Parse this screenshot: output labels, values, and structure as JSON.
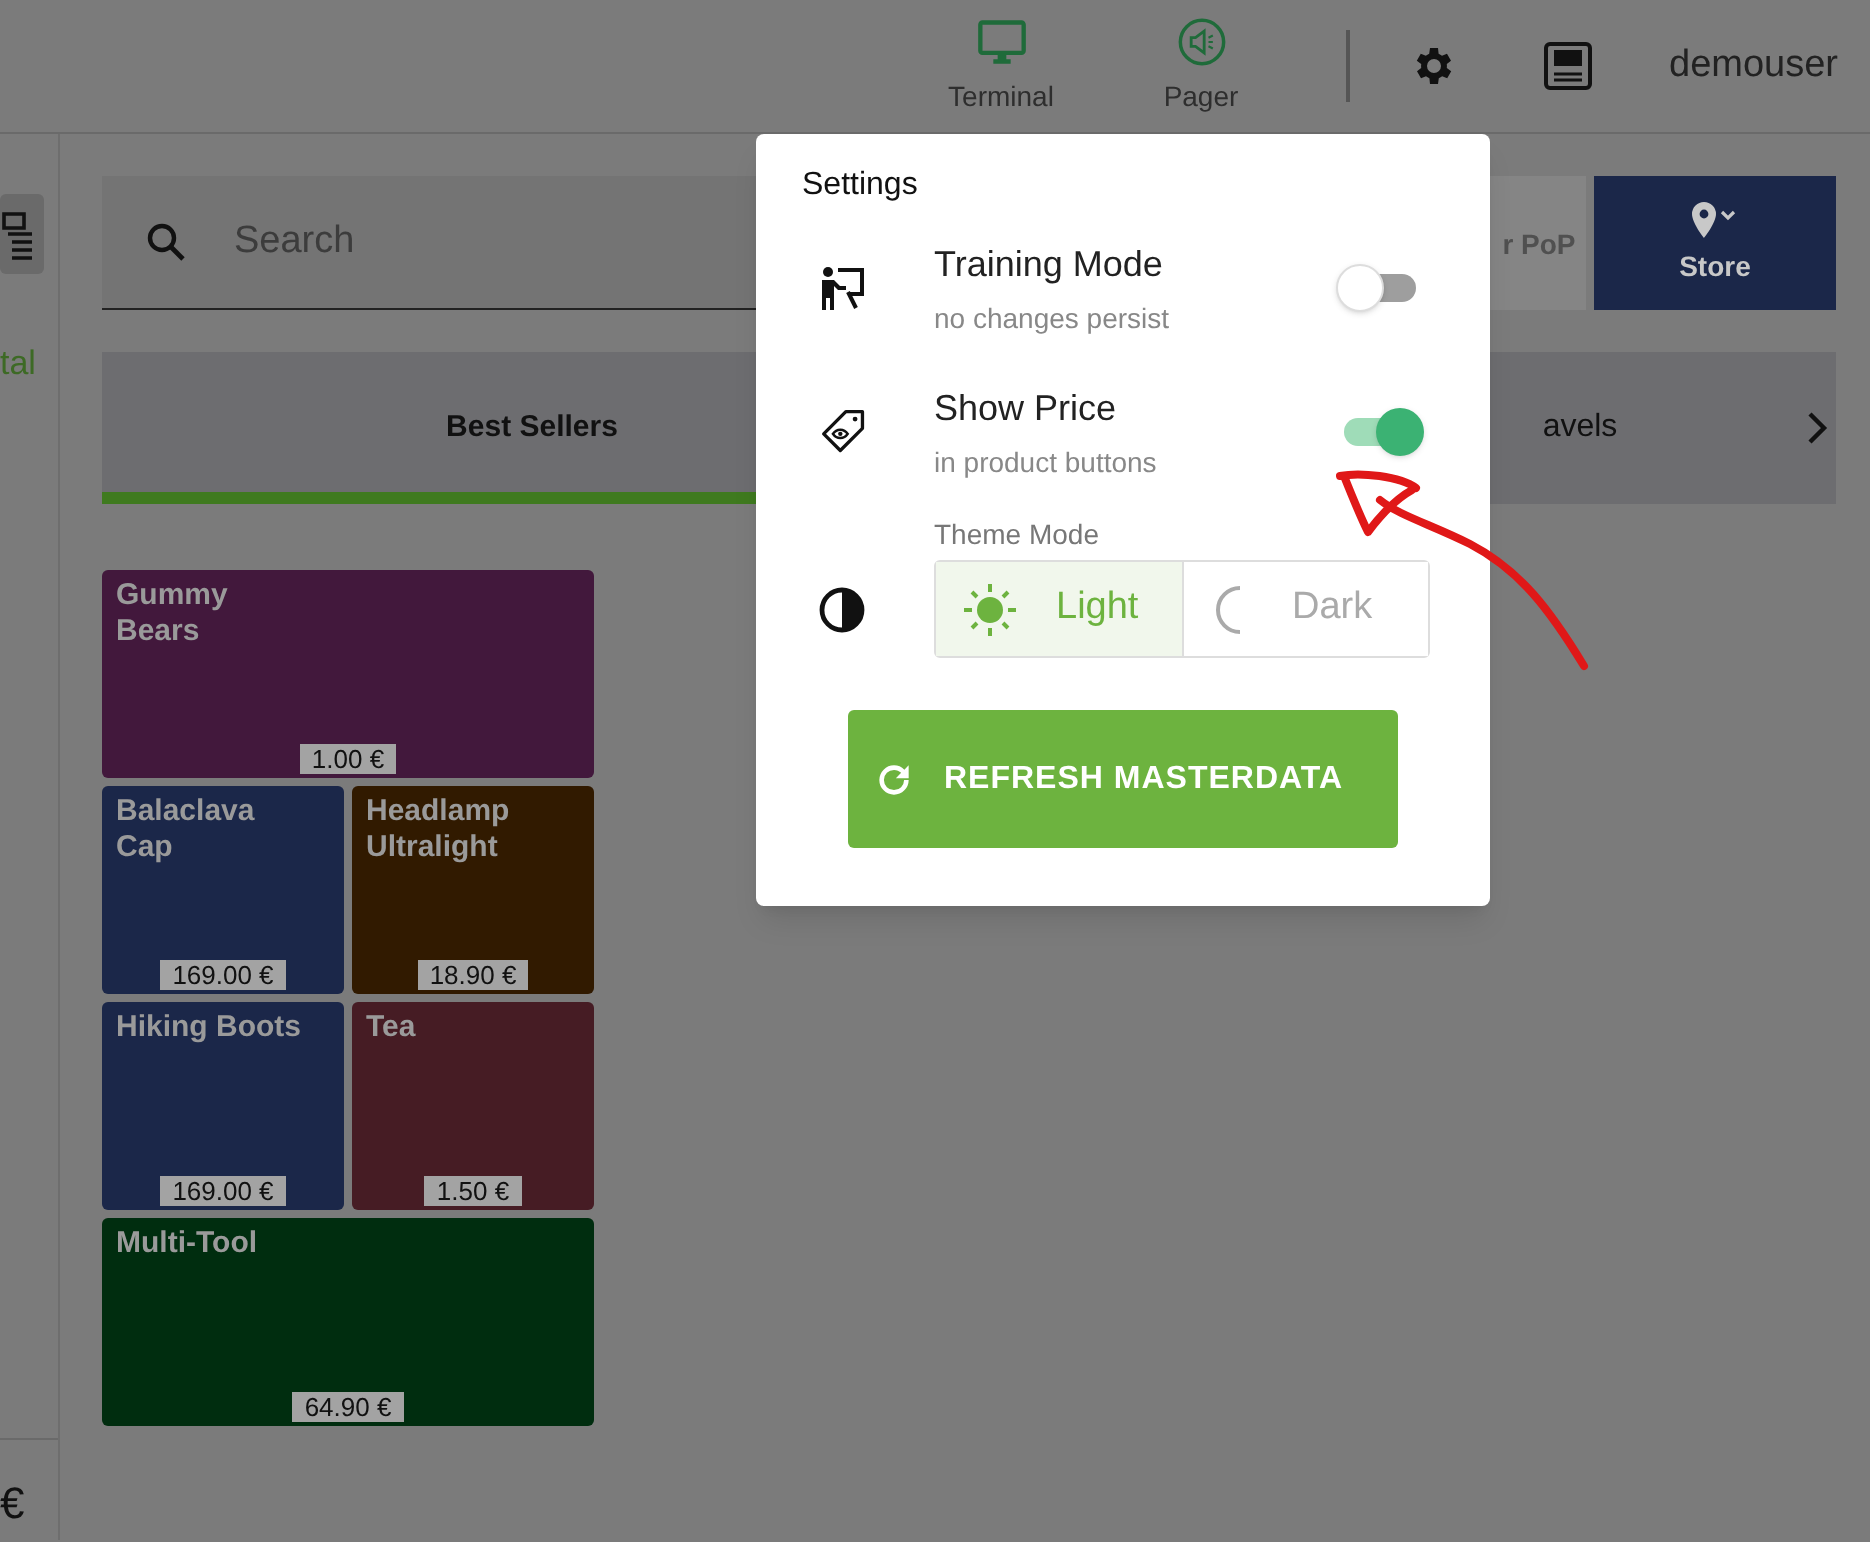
{
  "header": {
    "nav": [
      {
        "label": "Terminal",
        "kind": "terminal"
      },
      {
        "label": "Pager",
        "kind": "pager"
      }
    ],
    "user": "demouser"
  },
  "sidebar": {
    "label": "tal",
    "amount": "€"
  },
  "search": {
    "placeholder": "Search"
  },
  "actions": [
    {
      "label": "r PoP",
      "disabled": true
    },
    {
      "label": "Store",
      "disabled": false
    }
  ],
  "category_tabs": [
    {
      "label": "Best Sellers",
      "selected": true
    },
    {
      "label": "avels",
      "selected": false
    }
  ],
  "products": [
    {
      "name": "Gummy Bears",
      "price": "1.00 €",
      "color": "#42183c",
      "wide": true
    },
    {
      "name": "Balaclava Cap",
      "price": "169.00 €",
      "color": "#1b2749",
      "wide": false
    },
    {
      "name": "Headlamp Ultralight",
      "price": "18.90 €",
      "color": "#311a00",
      "wide": false
    },
    {
      "name": "Hiking Boots",
      "price": "169.00 €",
      "color": "#1b2749",
      "wide": false
    },
    {
      "name": "Tea",
      "price": "1.50 €",
      "color": "#461c24",
      "wide": false
    },
    {
      "name": "Multi-Tool",
      "price": "64.90 €",
      "color": "#002d0f",
      "wide": true
    }
  ],
  "settings": {
    "title": "Settings",
    "rows": [
      {
        "kind": "toggle",
        "label": "Training Mode",
        "hint": "no changes persist",
        "on": false
      },
      {
        "kind": "toggle",
        "label": "Show Price",
        "hint": "in product buttons",
        "on": true
      },
      {
        "kind": "theme",
        "label": "Theme Mode",
        "options": [
          {
            "label": "Light",
            "selected": true
          },
          {
            "label": "Dark",
            "selected": false
          }
        ]
      }
    ],
    "refresh_button": "REFRESH MASTERDATA"
  }
}
